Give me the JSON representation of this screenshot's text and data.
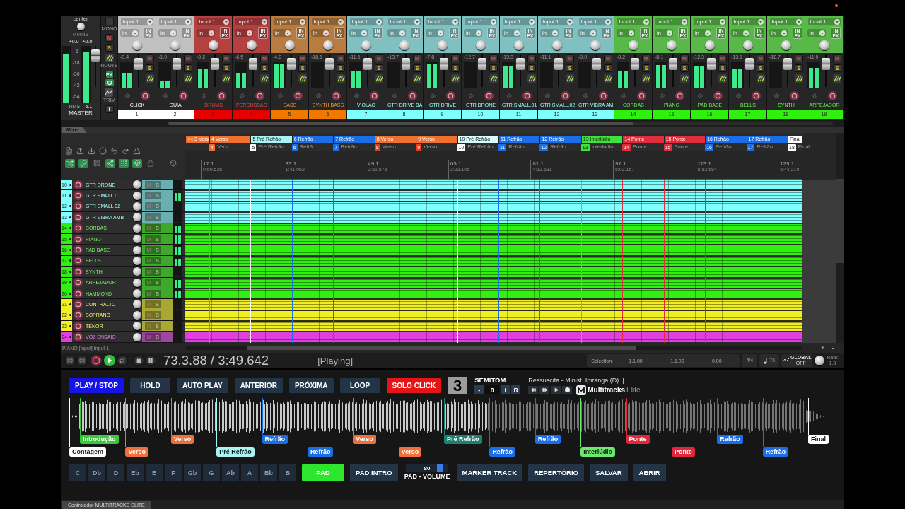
{
  "mixer": {
    "master": {
      "pan": "center",
      "volume": "0.00dB",
      "peaks": [
        "+0.0",
        "+0.0"
      ],
      "scale": [
        "-6",
        "-18",
        "-30",
        "-42",
        "-54"
      ],
      "meters": [
        {
          "level": 0.86
        },
        {
          "level": 0.9
        }
      ],
      "mode": "RMS",
      "reading": "-6.1",
      "name": "MASTER"
    },
    "controls": [
      {
        "kind": "toggle",
        "label": "MONO"
      },
      {
        "kind": "mute",
        "label": "M"
      },
      {
        "kind": "solo",
        "label": "S"
      },
      {
        "kind": "route",
        "label": "ROUTE"
      },
      {
        "kind": "fx",
        "label": "FX"
      },
      {
        "kind": "trim",
        "label": "TRIM"
      },
      {
        "kind": "info",
        "label": "i"
      }
    ],
    "channels": [
      {
        "input": "Input 1",
        "monitor": "in",
        "fx": "IN FX",
        "peak": "-0.4",
        "mute": "M",
        "solo": "S",
        "level": 0.6,
        "name": "CLICK",
        "number": "1",
        "color": "#ffffff"
      },
      {
        "input": "Input 1",
        "monitor": "in",
        "fx": "IN FX",
        "peak": "-1.0",
        "mute": "M",
        "solo": "S",
        "level": 0.3,
        "name": "GUIA",
        "number": "2",
        "color": "#ffffff"
      },
      {
        "input": "Input 1",
        "monitor": "in",
        "fx": "IN FX",
        "peak": "-0.2",
        "mute": "M",
        "solo": "S",
        "level": 0.75,
        "name": "DRUMS",
        "number": "3",
        "color": "#e80000"
      },
      {
        "input": "Input 1",
        "monitor": "in",
        "fx": "IN FX",
        "peak": "-6.5",
        "mute": "M",
        "solo": "S",
        "level": 0.6,
        "name": "PERCUSSAO",
        "number": "4",
        "color": "#e80000"
      },
      {
        "input": "Input 1",
        "monitor": "in",
        "fx": "IN FX",
        "peak": "-4.0",
        "mute": "M",
        "solo": "S",
        "level": 0.95,
        "name": "BASS",
        "number": "5",
        "color": "#f07800"
      },
      {
        "input": "Input 1",
        "monitor": "in",
        "fx": "IN FX",
        "peak": "-18.1",
        "mute": "M",
        "solo": "S",
        "level": 0,
        "name": "SYNTH BASS",
        "number": "6",
        "color": "#f07800"
      },
      {
        "input": "Input 1",
        "monitor": "in",
        "fx": "IN FX",
        "peak": "-11.6",
        "mute": "M",
        "solo": "S",
        "level": 0.7,
        "name": "VIOLAO",
        "number": "7",
        "color": "#80ffff"
      },
      {
        "input": "Input 1",
        "monitor": "in",
        "fx": "IN FX",
        "peak": "-13.7",
        "mute": "M",
        "solo": "S",
        "level": 0,
        "name": "GTR DRIVE BA",
        "number": "8",
        "color": "#80ffff"
      },
      {
        "input": "Input 1",
        "monitor": "in",
        "fx": "IN FX",
        "peak": "-7.8",
        "mute": "M",
        "solo": "S",
        "level": 0.95,
        "name": "GTR DRIVE",
        "number": "9",
        "color": "#80ffff"
      },
      {
        "input": "Input 1",
        "monitor": "in",
        "fx": "IN FX",
        "peak": "-12.7",
        "mute": "M",
        "solo": "S",
        "level": 0,
        "name": "GTR DRONE",
        "number": "10",
        "color": "#80ffff"
      },
      {
        "input": "Input 1",
        "monitor": "in",
        "fx": "IN FX",
        "peak": "-13.3",
        "mute": "M",
        "solo": "S",
        "level": 0.85,
        "name": "GTR SMALL.01",
        "number": "11",
        "color": "#80ffff"
      },
      {
        "input": "Input 1",
        "monitor": "in",
        "fx": "IN FX",
        "peak": "-11.1",
        "mute": "M",
        "solo": "S",
        "level": 0,
        "name": "GTR SMALL.02",
        "number": "12",
        "color": "#80ffff"
      },
      {
        "input": "Input 1",
        "monitor": "in",
        "fx": "IN FX",
        "peak": "-9.9",
        "mute": "M",
        "solo": "S",
        "level": 0,
        "name": "GTR VIBRA AM",
        "number": "13",
        "color": "#80ffff"
      },
      {
        "input": "Input 1",
        "monitor": "in",
        "fx": "IN FX",
        "peak": "-8.2",
        "mute": "M",
        "solo": "S",
        "level": 0.7,
        "name": "CORDAS",
        "number": "14",
        "color": "#30f010"
      },
      {
        "input": "Input 1",
        "monitor": "in",
        "fx": "IN FX",
        "peak": "-8.1",
        "mute": "M",
        "solo": "S",
        "level": 0.92,
        "name": "PIANO",
        "number": "15",
        "color": "#30f010"
      },
      {
        "input": "Input 1",
        "monitor": "in",
        "fx": "IN FX",
        "peak": "-12.3",
        "mute": "M",
        "solo": "S",
        "level": 0.85,
        "name": "PAD BASE",
        "number": "16",
        "color": "#30f010"
      },
      {
        "input": "Input 1",
        "monitor": "in",
        "fx": "IN FX",
        "peak": "-13.1",
        "mute": "M",
        "solo": "S",
        "level": 0.78,
        "name": "BELLS",
        "number": "17",
        "color": "#30f010"
      },
      {
        "input": "Input 1",
        "monitor": "in",
        "fx": "IN FX",
        "peak": "-18.7",
        "mute": "M",
        "solo": "S",
        "level": 0,
        "name": "SYNTH",
        "number": "18",
        "color": "#30f010"
      },
      {
        "input": "Input 1",
        "monitor": "in",
        "fx": "IN FX",
        "peak": "-11.0",
        "mute": "M",
        "solo": "S",
        "level": 0.8,
        "name": "ARPEJADOR",
        "number": "19",
        "color": "#30f010"
      }
    ],
    "tab": "Mixer"
  },
  "arrange": {
    "toolbar": [
      {
        "on": true
      },
      {
        "on": true
      },
      {
        "on": false
      },
      {
        "on": true
      },
      {
        "on": true
      },
      {
        "on": true
      },
      {
        "on": false
      },
      {
        "on": false
      }
    ],
    "regions": [
      {
        "label": "<< 3 Vers",
        "color": "#f07030"
      },
      {
        "label": "4 Verso",
        "color": "#f07030"
      },
      {
        "label": "5 Pré Refrão",
        "color": "#a8f4f4"
      },
      {
        "label": "6 Refrão",
        "color": "#1c6ee6"
      },
      {
        "label": "7 Refrão",
        "color": "#1c6ee6"
      },
      {
        "label": "8 Verso",
        "color": "#f07030"
      },
      {
        "label": "9 Verso",
        "color": "#f07030"
      },
      {
        "label": "10 Pré Refrão",
        "color": "#d8fcfc"
      },
      {
        "label": "11 Refrão",
        "color": "#1c6ee6"
      },
      {
        "label": "12 Refrão",
        "color": "#1c6ee6"
      },
      {
        "label": "13 Interlúdio",
        "color": "#40e040"
      },
      {
        "label": "14 Ponte",
        "color": "#e02c3c"
      },
      {
        "label": "15 Ponte",
        "color": "#e02c3c"
      },
      {
        "label": "16 Refrão",
        "color": "#1c6ee6"
      },
      {
        "label": "17 Refrão",
        "color": "#1c6ee6"
      },
      {
        "label": "Final",
        "color": "#ffffff"
      }
    ],
    "markers": [
      {
        "number": "4",
        "label": "Verso",
        "color": "#f07030"
      },
      {
        "number": "5",
        "label": "Pré Refrão",
        "color": "#ffffff"
      },
      {
        "number": "6",
        "label": "Refrão",
        "color": "#1c6ee6"
      },
      {
        "number": "7",
        "label": "Refrão",
        "color": "#1c6ee6"
      },
      {
        "number": "8",
        "label": "Verso",
        "color": "#e83c20"
      },
      {
        "number": "9",
        "label": "Verso",
        "color": "#e83c20"
      },
      {
        "number": "10",
        "label": "Pré Refrão",
        "color": "#ffffff"
      },
      {
        "number": "11",
        "label": "Refrão",
        "color": "#1c6ee6"
      },
      {
        "number": "12",
        "label": "Refrão",
        "color": "#1c6ee6"
      },
      {
        "number": "13",
        "label": "Interlúdio",
        "color": "#40e040"
      },
      {
        "number": "14",
        "label": "Ponte",
        "color": "#e02c3c"
      },
      {
        "number": "15",
        "label": "Ponte",
        "color": "#e02c3c"
      },
      {
        "number": "16",
        "label": "Refrão",
        "color": "#1c6ee6"
      },
      {
        "number": "17",
        "label": "Refrão",
        "color": "#1c6ee6"
      },
      {
        "number": "18",
        "label": "Final",
        "color": "#ffffff"
      }
    ],
    "ruler": [
      {
        "bar": "17.1",
        "time": "0:50.526"
      },
      {
        "bar": "33.1",
        "time": "1:41.052"
      },
      {
        "bar": "49.1",
        "time": "2:31.578"
      },
      {
        "bar": "65.1",
        "time": "3:22.105"
      },
      {
        "bar": "81.1",
        "time": "4:12.631"
      },
      {
        "bar": "97.1",
        "time": "5:03.157"
      },
      {
        "bar": "113.1",
        "time": "5:53.684"
      },
      {
        "bar": "129.1",
        "time": "6:44.210"
      }
    ],
    "tracks": [
      {
        "number": "10",
        "name": "GTR DRONE",
        "color": "#80ffff",
        "mute": "M",
        "solo": "S",
        "level": 0
      },
      {
        "number": "11",
        "name": "GTR SMALL 01",
        "color": "#80ffff",
        "mute": "M",
        "solo": "S",
        "level": 0.8
      },
      {
        "number": "12",
        "name": "GTR SMALL 02",
        "color": "#80ffff",
        "mute": "M",
        "solo": "S",
        "level": 0
      },
      {
        "number": "13",
        "name": "GTR VIBRA AMB",
        "color": "#80ffff",
        "mute": "M",
        "solo": "S",
        "level": 0
      },
      {
        "number": "14",
        "name": "CORDAS",
        "color": "#30f010",
        "mute": "M",
        "solo": "S",
        "level": 0.75
      },
      {
        "number": "15",
        "name": "PIANO",
        "color": "#30f010",
        "mute": "M",
        "solo": "S",
        "level": 0.9
      },
      {
        "number": "16",
        "name": "PAD BASE",
        "color": "#30f010",
        "mute": "M",
        "solo": "S",
        "level": 0.85
      },
      {
        "number": "17",
        "name": "BELLS",
        "color": "#30f010",
        "mute": "M",
        "solo": "S",
        "level": 0.8
      },
      {
        "number": "18",
        "name": "SYNTH",
        "color": "#30f010",
        "mute": "M",
        "solo": "S",
        "level": 0
      },
      {
        "number": "19",
        "name": "ARPEJADOR",
        "color": "#30f010",
        "mute": "M",
        "solo": "S",
        "level": 0.8
      },
      {
        "number": "20",
        "name": "HAMMOND",
        "color": "#30f010",
        "mute": "M",
        "solo": "S",
        "level": 0.8
      },
      {
        "number": "21",
        "name": "CONTRALTO",
        "color": "#f0f020",
        "mute": "M",
        "solo": "S",
        "level": 0
      },
      {
        "number": "22",
        "name": "SOPRANO",
        "color": "#f0f020",
        "mute": "M",
        "solo": "S",
        "level": 0
      },
      {
        "number": "23",
        "name": "TENOR",
        "color": "#f0f020",
        "mute": "M",
        "solo": "S",
        "level": 0
      },
      {
        "number": "24",
        "name": "VOZ ENSAIO",
        "color": "#e040e0",
        "mute": "M",
        "solo": "S",
        "level": 0
      }
    ],
    "track_info": "PIANO [input] Input 1",
    "zoom": [
      "+",
      "-"
    ]
  },
  "transport": {
    "playing": true,
    "position": "73.3.88 / 3:49.642",
    "state": "[Playing]",
    "selection_label": "Selection:",
    "selection": [
      "1.1.00",
      "1.1.00",
      "0.00"
    ],
    "meter": "4/4",
    "tempo": "76",
    "playrate_mode": "GLOBAL",
    "playrate_value": "OFF",
    "rate_label": "Rate:",
    "rate": "1.0"
  },
  "controller": {
    "buttons": [
      {
        "label": "PLAY / STOP",
        "on": true,
        "color": "#1414e6"
      },
      {
        "label": "HOLD",
        "on": false
      },
      {
        "label": "AUTO PLAY",
        "on": false
      },
      {
        "label": "ANTERIOR",
        "on": false
      },
      {
        "label": "PRÓXIMA",
        "on": false
      },
      {
        "label": "LOOP",
        "on": false
      },
      {
        "label": "SOLO CLICK",
        "on": true,
        "color": "#e61414"
      }
    ],
    "display": "3",
    "semitone": {
      "label": "SEMITOM",
      "minus": "-",
      "value": "0",
      "plus": "+",
      "reset": "R"
    },
    "song": "Ressuscita - Minist. Ipiranga (D)  |",
    "logo": {
      "name": "Multitracks",
      "suffix": "Elite"
    },
    "waveform": {
      "level": 0.555
    },
    "song_markers": [
      {
        "label": "Contagem",
        "color": "#ffffff"
      },
      {
        "label": "Introdução",
        "color": "#3cc83c"
      },
      {
        "label": "Verso",
        "color": "#f0703c"
      },
      {
        "label": "Verso",
        "color": "#f0703c"
      },
      {
        "label": "Pré Refrão",
        "color": "#a8f4f4"
      },
      {
        "label": "Refrão",
        "color": "#1c6ee6"
      },
      {
        "label": "Refrão",
        "color": "#1c6ee6"
      },
      {
        "label": "Verso",
        "color": "#f0703c"
      },
      {
        "label": "Verso",
        "color": "#f0703c"
      },
      {
        "label": "Pré Refrão",
        "color": "#1e8070"
      },
      {
        "label": "Refrão",
        "color": "#1c6ee6"
      },
      {
        "label": "Refrão",
        "color": "#1c6ee6"
      },
      {
        "label": "Interlúdio",
        "color": "#6ce86c"
      },
      {
        "label": "Ponte",
        "color": "#e0283c"
      },
      {
        "label": "Ponte",
        "color": "#e0283c"
      },
      {
        "label": "Refrão",
        "color": "#1c6ee6"
      },
      {
        "label": "Refrão",
        "color": "#1c6ee6"
      },
      {
        "label": "Final",
        "color": "#ffffff"
      }
    ],
    "keys": [
      {
        "label": "C",
        "selected": false
      },
      {
        "label": "Db",
        "selected": false
      },
      {
        "label": "D",
        "selected": false
      },
      {
        "label": "Eb",
        "selected": false
      },
      {
        "label": "E",
        "selected": false
      },
      {
        "label": "F",
        "selected": false
      },
      {
        "label": "Gb",
        "selected": false
      },
      {
        "label": "G",
        "selected": false
      },
      {
        "label": "Ab",
        "selected": false
      },
      {
        "label": "A",
        "selected": false
      },
      {
        "label": "Bb",
        "selected": false
      },
      {
        "label": "B",
        "selected": false
      }
    ],
    "pad_buttons": [
      {
        "label": "PAD",
        "on": true,
        "color": "#2ee62e"
      },
      {
        "label": "PAD INTRO",
        "on": false
      }
    ],
    "pad_volume": {
      "value": "80",
      "label": "PAD - VOLUME",
      "level": 0.8
    },
    "actions": [
      "MARKER TRACK",
      "REPERTÓRIO",
      "SALVAR",
      "ABRIR"
    ]
  },
  "status_tab": "Controlador MULTITRACKS ELITE"
}
